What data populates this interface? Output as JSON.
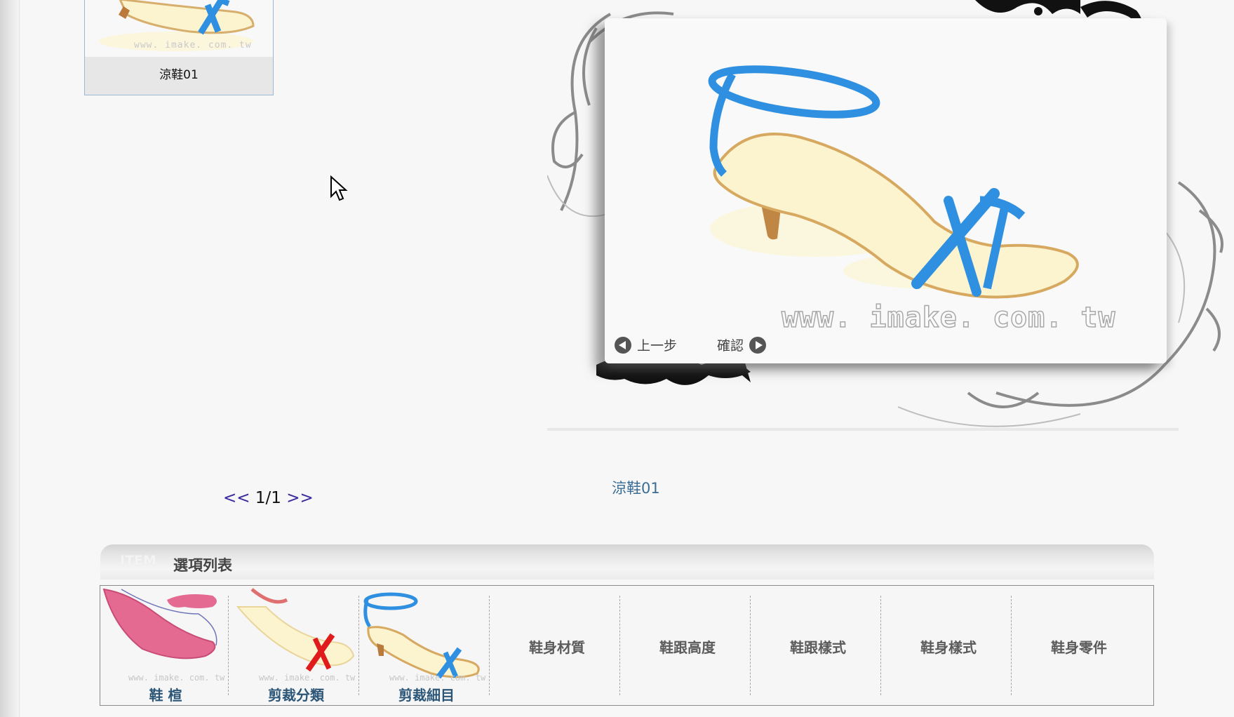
{
  "thumbnail": {
    "label": "涼鞋01",
    "watermark": "www. imake. com. tw"
  },
  "preview": {
    "watermark": "www. imake. com. tw",
    "prev_label": "上一步",
    "confirm_label": "確認",
    "caption": "涼鞋01"
  },
  "pager": {
    "prev": "<<",
    "page": "1/1",
    "next": ">>"
  },
  "options": {
    "header_tag": "ITEM",
    "header_title": "選項列表",
    "items": [
      {
        "label": "鞋 楦"
      },
      {
        "label": "剪裁分類"
      },
      {
        "label": "剪裁細目"
      },
      {
        "label": "鞋身材質"
      },
      {
        "label": "鞋跟高度"
      },
      {
        "label": "鞋跟樣式"
      },
      {
        "label": "鞋身樣式"
      },
      {
        "label": "鞋身零件"
      }
    ]
  },
  "colors": {
    "strap_blue": "#2f8fe0",
    "sole_cream": "#fbf4cf",
    "caption_blue": "#3b6c94",
    "pager_purple": "#3a2aa0"
  },
  "icons": [
    "mouse-cursor-icon",
    "arrow-left-circle-icon",
    "arrow-right-circle-icon"
  ]
}
